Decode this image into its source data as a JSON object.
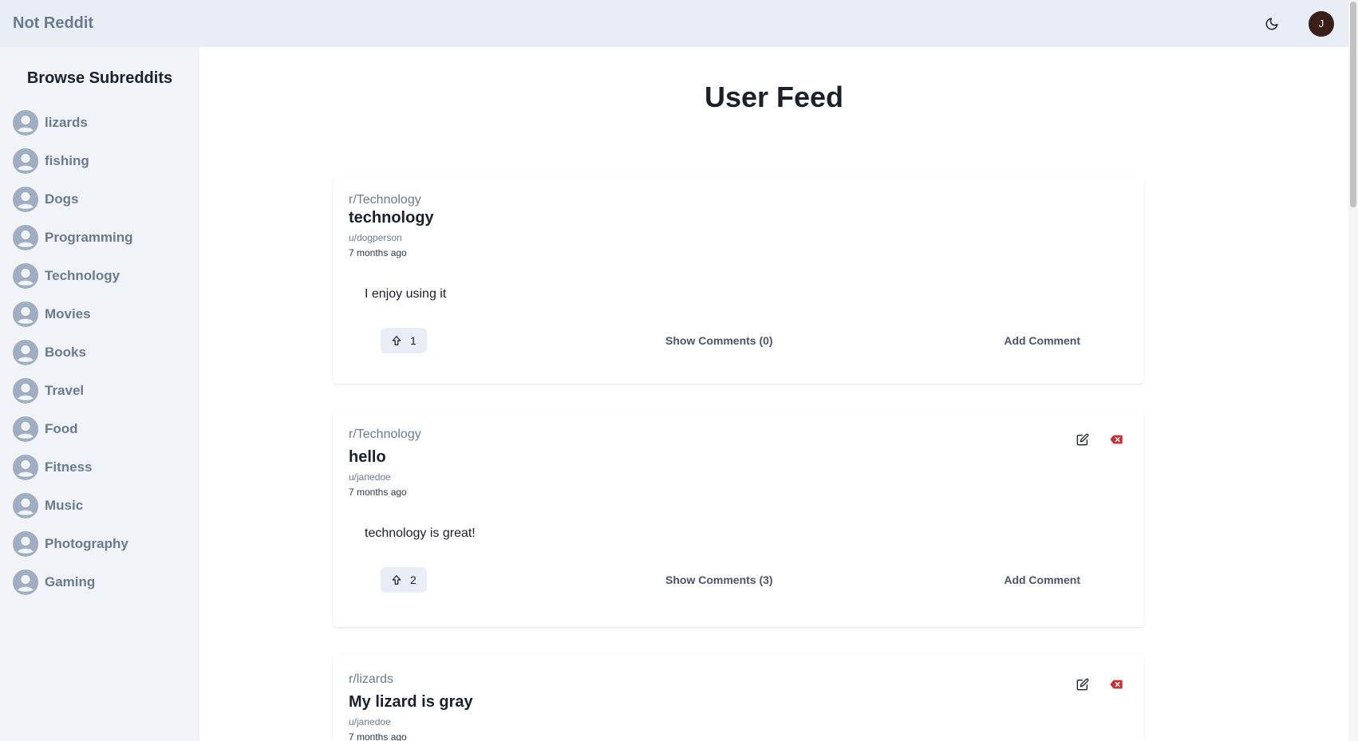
{
  "header": {
    "brand": "Not Reddit",
    "avatar_initial": "J",
    "theme_icon": "moon-icon"
  },
  "sidebar": {
    "title": "Browse Subreddits",
    "items": [
      {
        "label": "lizards"
      },
      {
        "label": "fishing"
      },
      {
        "label": "Dogs"
      },
      {
        "label": "Programming"
      },
      {
        "label": "Technology"
      },
      {
        "label": "Movies"
      },
      {
        "label": "Books"
      },
      {
        "label": "Travel"
      },
      {
        "label": "Food"
      },
      {
        "label": "Fitness"
      },
      {
        "label": "Music"
      },
      {
        "label": "Photography"
      },
      {
        "label": "Gaming"
      }
    ]
  },
  "main": {
    "title": "User Feed",
    "posts": [
      {
        "subreddit": "r/Technology",
        "title": "technology",
        "author": "u/dogperson",
        "time": "7 months ago",
        "body": "I enjoy using it",
        "votes": "1",
        "show_comments": "Show Comments (0)",
        "add_comment": "Add Comment",
        "owned": false
      },
      {
        "subreddit": "r/Technology",
        "title": "hello",
        "author": "u/janedoe",
        "time": "7 months ago",
        "body": "technology is great!",
        "votes": "2",
        "show_comments": "Show Comments (3)",
        "add_comment": "Add Comment",
        "owned": true
      },
      {
        "subreddit": "r/lizards",
        "title": "My lizard is gray",
        "author": "u/janedoe",
        "time": "7 months ago",
        "owned": true
      }
    ]
  },
  "colors": {
    "accent": "#6b7a90",
    "delete": "#c53030",
    "avatar_bg": "#3a1e18"
  }
}
